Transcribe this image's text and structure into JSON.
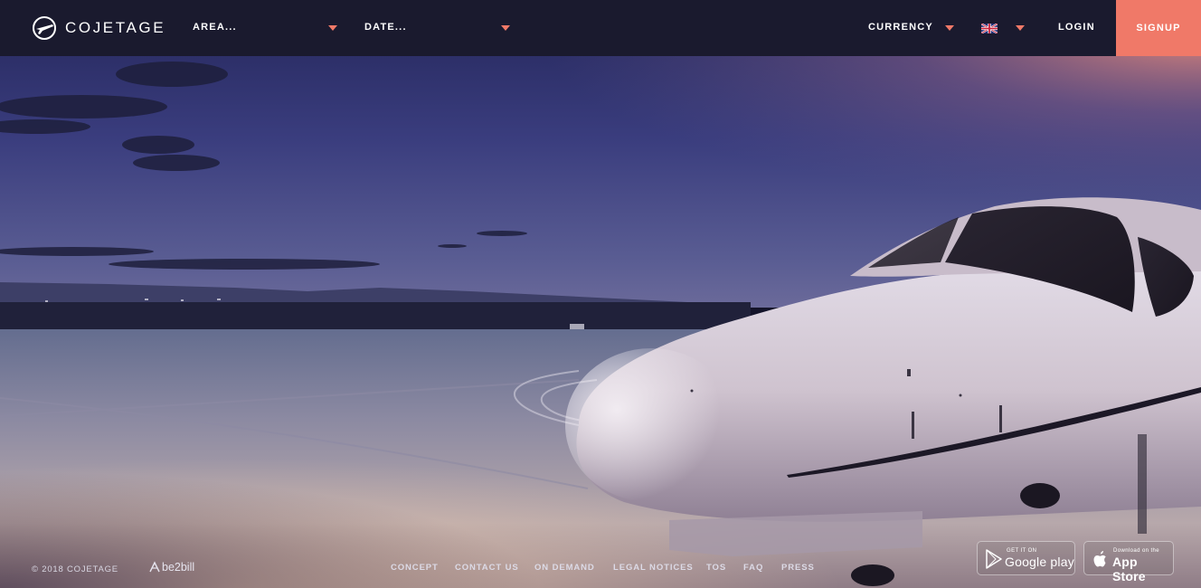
{
  "brand": {
    "name": "COJETAGE"
  },
  "nav": {
    "area": "AREA...",
    "date": "DATE...",
    "currency": "CURRENCY",
    "language_flag": "uk-flag-icon",
    "login": "LOGIN",
    "signup": "SIGNUP"
  },
  "footer": {
    "copyright": "© 2018 COJETAGE",
    "partner": "be2bill",
    "links": [
      "CONCEPT",
      "CONTACT US",
      "ON DEMAND",
      "LEGAL NOTICES",
      "TOS",
      "FAQ",
      "PRESS"
    ],
    "google_play": {
      "small": "GET IT ON",
      "big": "Google play"
    },
    "app_store": {
      "small": "Download on the",
      "big": "App Store"
    }
  },
  "colors": {
    "accent": "#f07968",
    "topbar": "#1a1a2e",
    "sky_top": "#2c2d63",
    "sky_glow": "#d27f78"
  },
  "icons": [
    "plane-logo-icon",
    "chevron-down-icon",
    "uk-flag-icon",
    "be2bill-logo-icon",
    "google-play-icon",
    "apple-icon"
  ]
}
